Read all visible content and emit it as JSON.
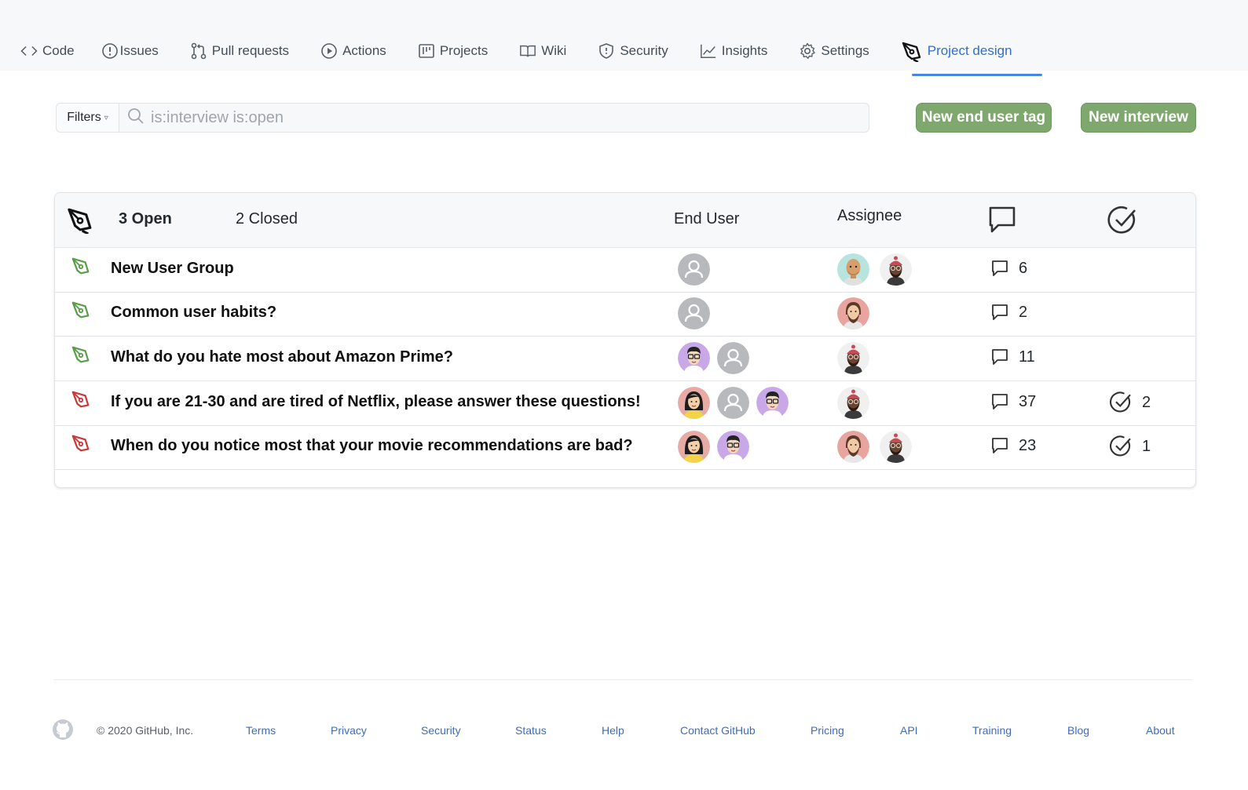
{
  "nav": {
    "tabs": [
      {
        "label": "Code",
        "icon": "code-icon"
      },
      {
        "label": "Issues",
        "icon": "issue-icon"
      },
      {
        "label": "Pull requests",
        "icon": "pull-request-icon"
      },
      {
        "label": "Actions",
        "icon": "play-icon"
      },
      {
        "label": "Projects",
        "icon": "project-board-icon"
      },
      {
        "label": "Wiki",
        "icon": "book-icon"
      },
      {
        "label": "Security",
        "icon": "shield-icon"
      },
      {
        "label": "Insights",
        "icon": "graph-icon"
      },
      {
        "label": "Settings",
        "icon": "gear-icon"
      },
      {
        "label": "Project design",
        "icon": "pen-nib-icon",
        "active": true
      }
    ]
  },
  "filter": {
    "button_label": "Filters",
    "caret": "▿",
    "search_placeholder": "is:interview is:open"
  },
  "actions": {
    "new_tag_label": "New end user tag",
    "new_interview_label": "New interview"
  },
  "table": {
    "open_label": "3 Open",
    "closed_label": "2 Closed",
    "end_user_header": "End User",
    "assignee_header": "Assignee",
    "rows": [
      {
        "title": "New User Group",
        "status": "open",
        "status_color": "#5a9e4b",
        "end_users": [
          "generic"
        ],
        "assignees": [
          "man-bald-teal",
          "man-beanie"
        ],
        "comments": "6",
        "checks": ""
      },
      {
        "title": "Common user habits?",
        "status": "open",
        "status_color": "#5a9e4b",
        "end_users": [
          "generic"
        ],
        "assignees": [
          "man-beard-red"
        ],
        "comments": "2",
        "checks": ""
      },
      {
        "title": "What do you hate most about Amazon Prime?",
        "status": "open",
        "status_color": "#5a9e4b",
        "end_users": [
          "man-glasses-purple",
          "generic"
        ],
        "assignees": [
          "man-beanie"
        ],
        "comments": "11",
        "checks": ""
      },
      {
        "title": "If you are 21-30 and are tired of Netflix, please answer these questions!",
        "status": "closed",
        "status_color": "#c83a3a",
        "end_users": [
          "woman-black-hair",
          "generic",
          "man-glasses-purple"
        ],
        "assignees": [
          "man-beanie"
        ],
        "comments": "37",
        "checks": "2"
      },
      {
        "title": "When do you notice most that your movie recommendations are bad?",
        "status": "closed",
        "status_color": "#c83a3a",
        "end_users": [
          "woman-black-hair",
          "man-glasses-purple"
        ],
        "assignees": [
          "man-beard-red",
          "man-beanie"
        ],
        "comments": "23",
        "checks": "1"
      }
    ]
  },
  "footer": {
    "copyright": "© 2020 GitHub, Inc.",
    "links": [
      "Terms",
      "Privacy",
      "Security",
      "Status",
      "Help",
      "Contact GitHub",
      "Pricing",
      "API",
      "Training",
      "Blog",
      "About"
    ]
  },
  "colors": {
    "accent": "#2f6fd0",
    "button_green": "#7fa86e",
    "open_green": "#5a9e4b",
    "closed_red": "#c83a3a"
  }
}
